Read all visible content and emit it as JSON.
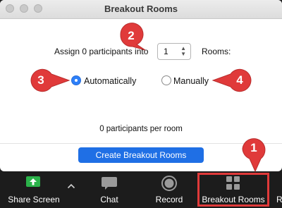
{
  "window": {
    "title": "Breakout Rooms"
  },
  "dialog": {
    "assign_prefix": "Assign 0 participants into",
    "rooms_count": "1",
    "rooms_suffix": "Rooms:",
    "option_automatic": "Automatically",
    "option_manual": "Manually",
    "selected_option": "Automatically",
    "per_room_text": "0 participants per room",
    "create_button": "Create Breakout Rooms"
  },
  "callouts": [
    {
      "number": "1",
      "target": "Breakout Rooms button"
    },
    {
      "number": "2",
      "target": "rooms stepper"
    },
    {
      "number": "3",
      "target": "Automatically option"
    },
    {
      "number": "4",
      "target": "Manually option"
    }
  ],
  "toolbar": {
    "share_screen": "Share Screen",
    "chat": "Chat",
    "record": "Record",
    "breakout_rooms": "Breakout Rooms",
    "overflow": "R"
  },
  "colors": {
    "accent_blue": "#1f6fe5",
    "callout_red": "#e03a3a",
    "share_green": "#2bb34a",
    "toolbar_bg": "#1c1c1c"
  },
  "icons": {
    "share": "up-arrow-icon",
    "expand": "chevron-up-icon",
    "chat": "speech-bubble-icon",
    "record": "record-dot-icon",
    "breakout": "four-squares-grid-icon"
  }
}
